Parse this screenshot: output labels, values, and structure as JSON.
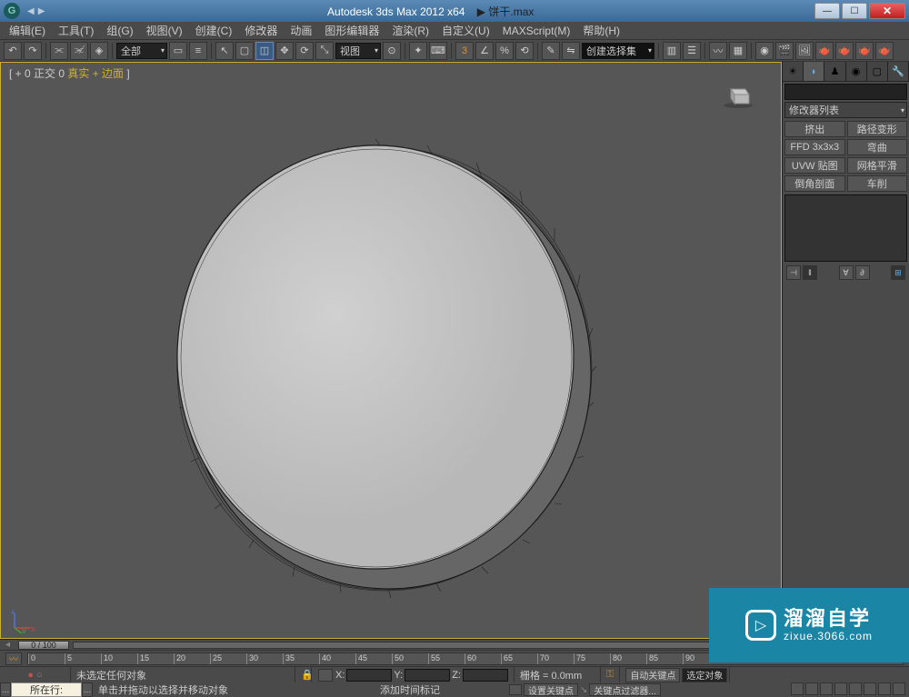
{
  "title": {
    "app": "Autodesk 3ds Max  2012 x64",
    "file": "饼干.max"
  },
  "menu": [
    "编辑(E)",
    "工具(T)",
    "组(G)",
    "视图(V)",
    "创建(C)",
    "修改器",
    "动画",
    "图形编辑器",
    "渲染(R)",
    "自定义(U)",
    "MAXScript(M)",
    "帮助(H)"
  ],
  "toolbar": {
    "filter_label": "全部",
    "view_label": "视图",
    "selset_label": "创建选择集"
  },
  "viewport": {
    "label_left": "[ + 0 正交 0 ",
    "label_real": "真实 + 边面",
    "label_right": " ]"
  },
  "cmd_panel": {
    "mod_list_label": "修改器列表",
    "btns": [
      [
        "挤出",
        "路径变形"
      ],
      [
        "FFD 3x3x3",
        "弯曲"
      ],
      [
        "UVW 贴图",
        "网格平滑"
      ],
      [
        "倒角剖面",
        "车削"
      ]
    ]
  },
  "timeslider": {
    "pos": "0 / 100"
  },
  "trackbar": {
    "ticks": [
      0,
      5,
      10,
      15,
      20,
      25,
      30,
      35,
      40,
      45,
      50,
      55,
      60,
      65,
      70,
      75,
      80,
      85,
      90
    ]
  },
  "status": {
    "no_selection": "未选定任何对象",
    "hint": "单击并拖动以选择并移动对象",
    "add_time_tag": "添加时间标记",
    "x_label": "X:",
    "y_label": "Y:",
    "z_label": "Z:",
    "grid_label": "栅格 = 0.0mm",
    "autokey": "自动关键点",
    "setkey": "设置关键点",
    "selected_lock": "选定对象",
    "keyfilter": "关键点过滤器...",
    "row_label": "所在行:"
  },
  "watermark": {
    "line1": "溜溜自学",
    "line2": "zixue.3066.com"
  }
}
